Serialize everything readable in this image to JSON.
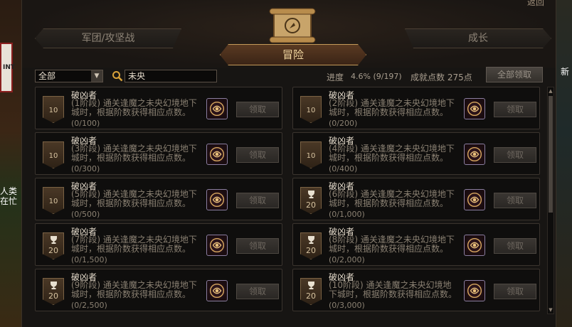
{
  "background": {
    "left_sign": "INT",
    "left_caption": "人类\n在忙",
    "right_text": "新"
  },
  "window": {
    "close_label": "返回"
  },
  "tabs": {
    "left": "军团/攻坚战",
    "active": "冒险",
    "right": "成长"
  },
  "filter": {
    "category_selected": "全部",
    "search_value": "未央"
  },
  "stats": {
    "progress_label": "进度",
    "progress_value": "4.6% (9/197)",
    "points_label": "成就点数 275点"
  },
  "claim_all_label": "全部领取",
  "achievements": [
    {
      "title": "破凶者",
      "desc": "(1阶段) 通关逢魔之未央幻境地下城时，根据阶数获得相应点数。",
      "count": "(0/100)",
      "badge": "10",
      "trophy": false,
      "claim": "领取"
    },
    {
      "title": "破凶者",
      "desc": "(2阶段) 通关逢魔之未央幻境地下城时，根据阶数获得相应点数。",
      "count": "(0/200)",
      "badge": "10",
      "trophy": false,
      "claim": "领取"
    },
    {
      "title": "破凶者",
      "desc": "(3阶段) 通关逢魔之未央幻境地下城时，根据阶数获得相应点数。",
      "count": "(0/300)",
      "badge": "10",
      "trophy": false,
      "claim": "领取"
    },
    {
      "title": "破凶者",
      "desc": "(4阶段) 通关逢魔之未央幻境地下城时，根据阶数获得相应点数。",
      "count": "(0/400)",
      "badge": "10",
      "trophy": false,
      "claim": "领取"
    },
    {
      "title": "破凶者",
      "desc": "(5阶段) 通关逢魔之未央幻境地下城时，根据阶数获得相应点数。",
      "count": "(0/500)",
      "badge": "10",
      "trophy": false,
      "claim": "领取"
    },
    {
      "title": "破凶者",
      "desc": "(6阶段) 通关逢魔之未央幻境地下城时，根据阶数获得相应点数。",
      "count": "(0/1,000)",
      "badge": "20",
      "trophy": true,
      "claim": "领取"
    },
    {
      "title": "破凶者",
      "desc": "(7阶段) 通关逢魔之未央幻境地下城时，根据阶数获得相应点数。",
      "count": "(0/1,500)",
      "badge": "20",
      "trophy": true,
      "claim": "领取"
    },
    {
      "title": "破凶者",
      "desc": "(8阶段) 通关逢魔之未央幻境地下城时，根据阶数获得相应点数。",
      "count": "(0/2,000)",
      "badge": "20",
      "trophy": true,
      "claim": "领取"
    },
    {
      "title": "破凶者",
      "desc": "(9阶段) 通关逢魔之未央幻境地下城时，根据阶数获得相应点数。",
      "count": "(0/2,500)",
      "badge": "20",
      "trophy": true,
      "claim": "领取"
    },
    {
      "title": "破凶者",
      "desc": "(10阶段) 通关逢魔之未央幻境地下城时，根据阶数获得相应点数。",
      "count": "(0/3,000)",
      "badge": "20",
      "trophy": true,
      "claim": "领取"
    }
  ]
}
